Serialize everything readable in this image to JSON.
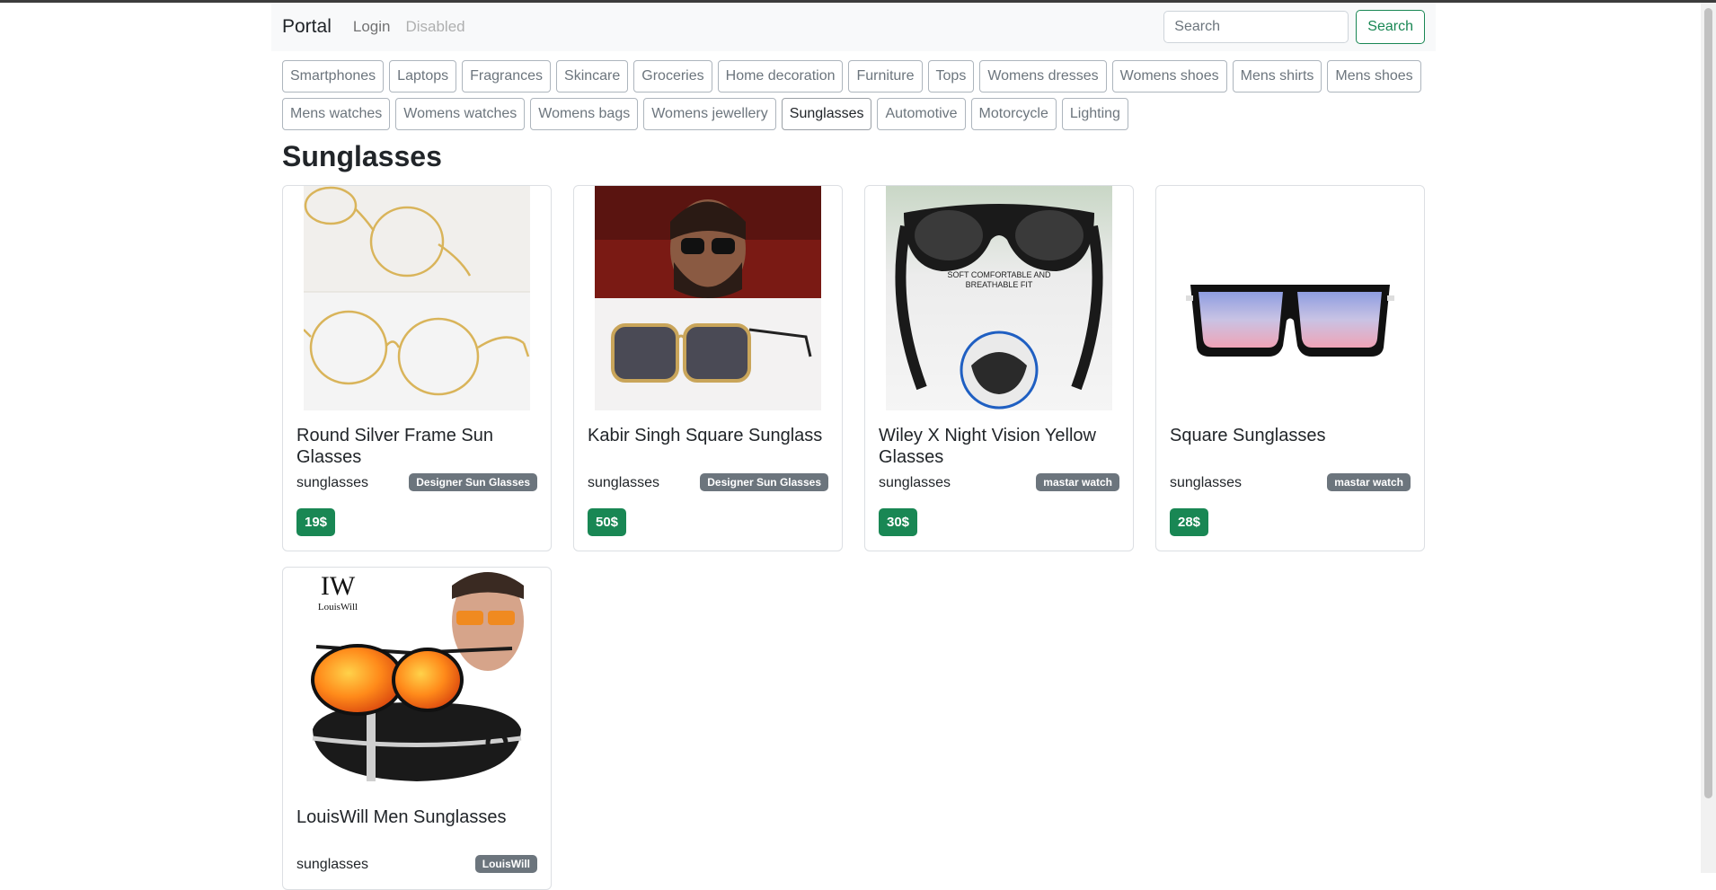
{
  "navbar": {
    "brand": "Portal",
    "links": [
      "Login",
      "Disabled"
    ],
    "search_placeholder": "Search",
    "search_button": "Search"
  },
  "categories": [
    "Smartphones",
    "Laptops",
    "Fragrances",
    "Skincare",
    "Groceries",
    "Home decoration",
    "Furniture",
    "Tops",
    "Womens dresses",
    "Womens shoes",
    "Mens shirts",
    "Mens shoes",
    "Mens watches",
    "Womens watches",
    "Womens bags",
    "Womens jewellery",
    "Sunglasses",
    "Automotive",
    "Motorcycle",
    "Lighting"
  ],
  "active_category": "Sunglasses",
  "page_title": "Sunglasses",
  "products": [
    {
      "title": "Round Silver Frame Sun Glasses",
      "category": "sunglasses",
      "brand": "Designer Sun Glasses",
      "price": "19$",
      "image_icon": "round-gold-glasses-image"
    },
    {
      "title": "Kabir Singh Square Sunglass",
      "category": "sunglasses",
      "brand": "Designer Sun Glasses",
      "price": "50$",
      "image_icon": "square-sunglass-image"
    },
    {
      "title": "Wiley X Night Vision Yellow Glasses",
      "category": "sunglasses",
      "brand": "mastar watch",
      "price": "30$",
      "image_icon": "sport-glasses-image",
      "image_caption": "SOFT COMFORTABLE AND BREATHABLE FIT"
    },
    {
      "title": "Square Sunglasses",
      "category": "sunglasses",
      "brand": "mastar watch",
      "price": "28$",
      "image_icon": "gradient-square-sunglasses-image"
    },
    {
      "title": "LouisWill Men Sunglasses",
      "category": "sunglasses",
      "brand": "LouisWill",
      "price": "",
      "image_icon": "orange-mirror-sunglasses-image",
      "image_logo": "LouisWill"
    }
  ],
  "colors": {
    "success": "#198754",
    "secondary": "#6c757d",
    "navbar_bg": "#f8f9fa"
  }
}
